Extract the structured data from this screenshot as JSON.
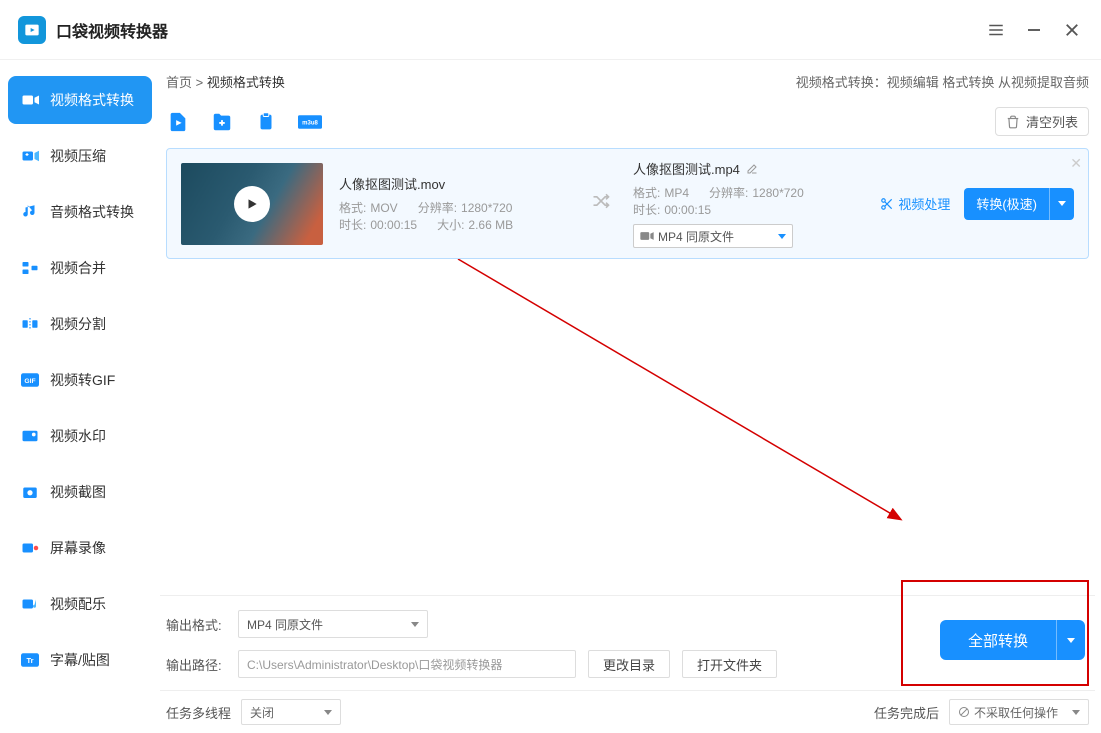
{
  "app": {
    "title": "口袋视频转换器"
  },
  "breadcrumb": {
    "home": "首页",
    "current": "视频格式转换"
  },
  "header_note": {
    "prefix": "视频格式转换：",
    "rest": "视频编辑 格式转换 从视频提取音频"
  },
  "sidebar": {
    "items": [
      {
        "label": "视频格式转换"
      },
      {
        "label": "视频压缩"
      },
      {
        "label": "音频格式转换"
      },
      {
        "label": "视频合并"
      },
      {
        "label": "视频分割"
      },
      {
        "label": "视频转GIF"
      },
      {
        "label": "视频水印"
      },
      {
        "label": "视频截图"
      },
      {
        "label": "屏幕录像"
      },
      {
        "label": "视频配乐"
      },
      {
        "label": "字幕/贴图"
      }
    ]
  },
  "toolbar": {
    "clear": "清空列表",
    "m3u8": "m3u8"
  },
  "file": {
    "src": {
      "name": "人像抠图测试.mov",
      "format_lbl": "格式:",
      "format": "MOV",
      "res_lbl": "分辨率:",
      "res": "1280*720",
      "dur_lbl": "时长:",
      "dur": "00:00:15",
      "size_lbl": "大小:",
      "size": "2.66 MB"
    },
    "dst": {
      "name": "人像抠图测试.mp4",
      "format_lbl": "格式:",
      "format": "MP4",
      "res_lbl": "分辨率:",
      "res": "1280*720",
      "dur_lbl": "时长:",
      "dur": "00:00:15",
      "select": "MP4 同原文件"
    },
    "process": "视频处理",
    "convert": "转换(极速)"
  },
  "bottom": {
    "out_fmt_lbl": "输出格式:",
    "out_fmt": "MP4 同原文件",
    "out_path_lbl": "输出路径:",
    "out_path": "C:\\Users\\Administrator\\Desktop\\口袋视频转换器",
    "change_dir": "更改目录",
    "open_dir": "打开文件夹",
    "convert_all": "全部转换"
  },
  "footer": {
    "thread_lbl": "任务多线程",
    "thread_val": "关闭",
    "after_lbl": "任务完成后",
    "after_val": "不采取任何操作"
  }
}
